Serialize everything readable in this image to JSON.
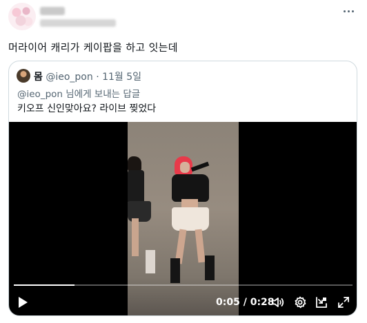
{
  "tweet": {
    "text": "머라이어 캐리가 케이팝을 하고 잇는데"
  },
  "quoted": {
    "display_name": "몸",
    "handle": "@ieo_pon",
    "separator": "·",
    "date": "11월 5일",
    "reply_mention": "@ieo_pon",
    "reply_suffix": " 님에게 보내는 답글",
    "text": "키오프 신인맞아요? 라이브 찢었다"
  },
  "video": {
    "current_time": "0:05",
    "time_separator": " / ",
    "duration": "0:28",
    "progress": 0.18
  },
  "icons": [
    "more-icon",
    "play-icon",
    "volume-icon",
    "settings-icon",
    "pip-icon",
    "fullscreen-icon"
  ]
}
